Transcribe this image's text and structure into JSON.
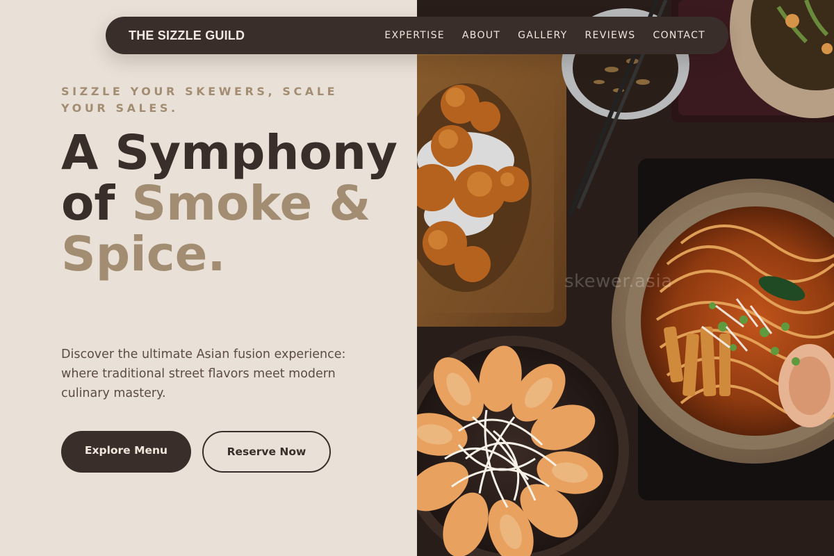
{
  "nav": {
    "brand": "THE SIZZLE GUILD",
    "links": [
      "EXPERTISE",
      "ABOUT",
      "GALLERY",
      "REVIEWS",
      "CONTACT"
    ]
  },
  "hero": {
    "eyebrow": "SIZZLE YOUR SKEWERS, SCALE YOUR SALES.",
    "headline_part1": "A Symphony of ",
    "headline_accent": "Smoke & Spice.",
    "description": "Discover the ultimate Asian fusion experience: where traditional street flavors meet modern culinary mastery.",
    "primary_button": "Explore Menu",
    "secondary_button": "Reserve Now"
  },
  "photo": {
    "watermark": "skewer.asia",
    "subject": "food-photo"
  },
  "colors": {
    "background": "#e9e0d7",
    "dark": "#3a2e2a",
    "accent": "#a38d72"
  }
}
